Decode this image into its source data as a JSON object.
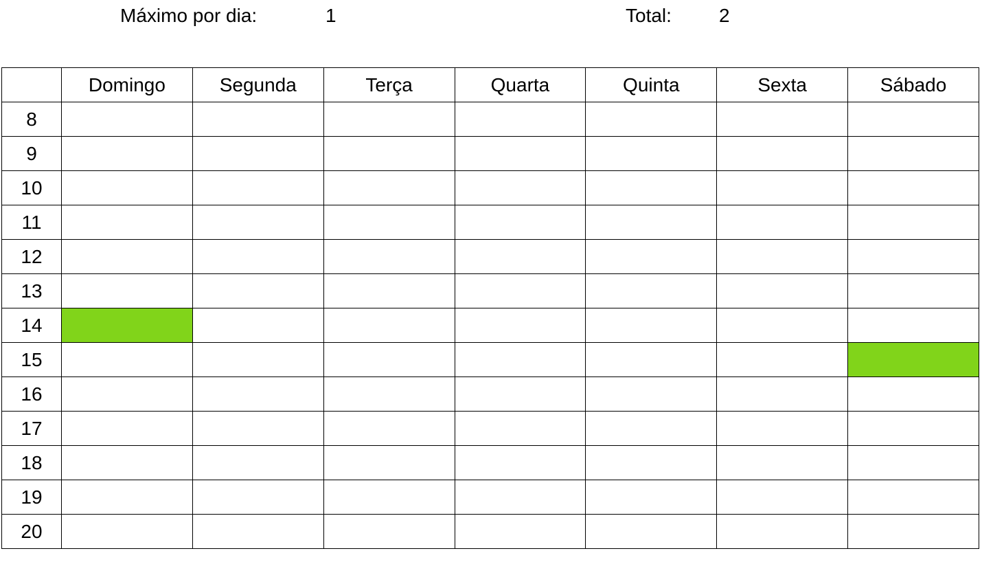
{
  "summary": {
    "max_per_day_label": "Máximo por dia:",
    "max_per_day_value": "1",
    "total_label": "Total:",
    "total_value": "2"
  },
  "days": [
    "Domingo",
    "Segunda",
    "Terça",
    "Quarta",
    "Quinta",
    "Sexta",
    "Sábado"
  ],
  "hours": [
    "8",
    "9",
    "10",
    "11",
    "12",
    "13",
    "14",
    "15",
    "16",
    "17",
    "18",
    "19",
    "20"
  ],
  "booked": [
    {
      "day": "Domingo",
      "hour": "14"
    },
    {
      "day": "Sábado",
      "hour": "15"
    }
  ],
  "colors": {
    "booked": "#81d41a",
    "grid": "#000000"
  }
}
